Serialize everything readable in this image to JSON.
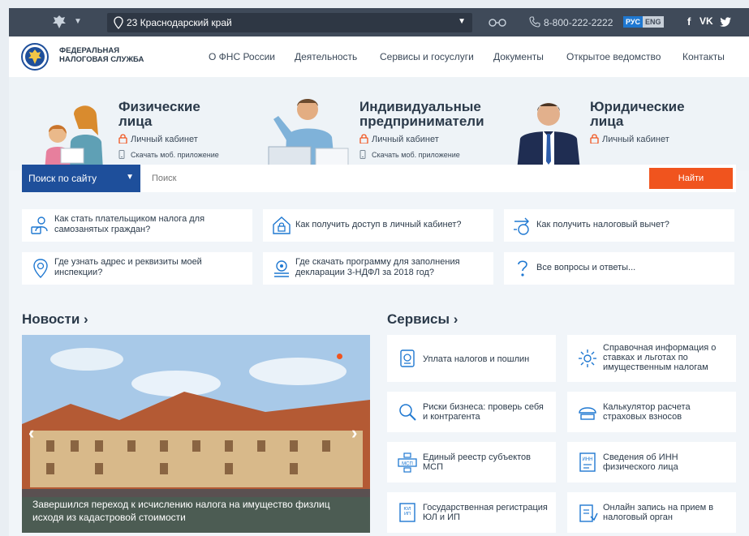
{
  "topbar": {
    "region": "23 Краснодарский край",
    "phone": "8-800-222-2222",
    "lang_ru": "РУС",
    "lang_en": "ENG",
    "social": [
      "f",
      "vk",
      "twitter"
    ]
  },
  "header": {
    "logo_line1": "ФЕДЕРАЛЬНАЯ",
    "logo_line2": "НАЛОГОВАЯ СЛУЖБА",
    "nav": [
      "О ФНС России",
      "Деятельность",
      "Сервисы и госуслуги",
      "Документы",
      "Открытое ведомство",
      "Контакты"
    ]
  },
  "hero": {
    "individuals": {
      "title1": "Физические",
      "title2": "лица",
      "cabinet": "Личный кабинет",
      "app": "Скачать моб. приложение"
    },
    "entrepreneurs": {
      "title1": "Индивидуальные",
      "title2": "предприниматели",
      "cabinet": "Личный кабинет",
      "app": "Скачать моб. приложение"
    },
    "legal": {
      "title1": "Юридические",
      "title2": "лица",
      "cabinet": "Личный кабинет"
    }
  },
  "search": {
    "scope": "Поиск по сайту",
    "placeholder": "Поиск",
    "button": "Найти"
  },
  "faq": [
    "Как стать плательщиком налога для самозанятых граждан?",
    "Как получить доступ в личный кабинет?",
    "Как получить налоговый вычет?",
    "Где узнать адрес и реквизиты моей инспекции?",
    "Где скачать программу для заполнения декларации 3-НДФЛ за 2018 год?",
    "Все вопросы и ответы..."
  ],
  "news": {
    "title": "Новости",
    "caption": "Завершился переход к исчислению налога на имущество физлиц исходя из кадастровой стоимости"
  },
  "services": {
    "title": "Сервисы",
    "items": [
      "Уплата налогов и пошлин",
      "Справочная информация о ставках и льготах по имущественным налогам",
      "Риски бизнеса: проверь себя и контрагента",
      "Калькулятор расчета страховых взносов",
      "Единый реестр субъектов МСП",
      "Сведения об ИНН физического лица",
      "Государственная регистрация ЮЛ и ИП",
      "Онлайн запись на прием в налоговый орган"
    ]
  },
  "colors": {
    "topbar": "#3f4a59",
    "accent": "#1e4f9b",
    "button": "#f0541e",
    "link": "#1f78d1"
  },
  "icons": [
    "emblem-icon",
    "location-pin-icon",
    "glasses-icon",
    "phone-icon",
    "lock-icon",
    "mobile-icon",
    "chevron-down-icon",
    "chevron-left-icon",
    "chevron-right-icon"
  ]
}
